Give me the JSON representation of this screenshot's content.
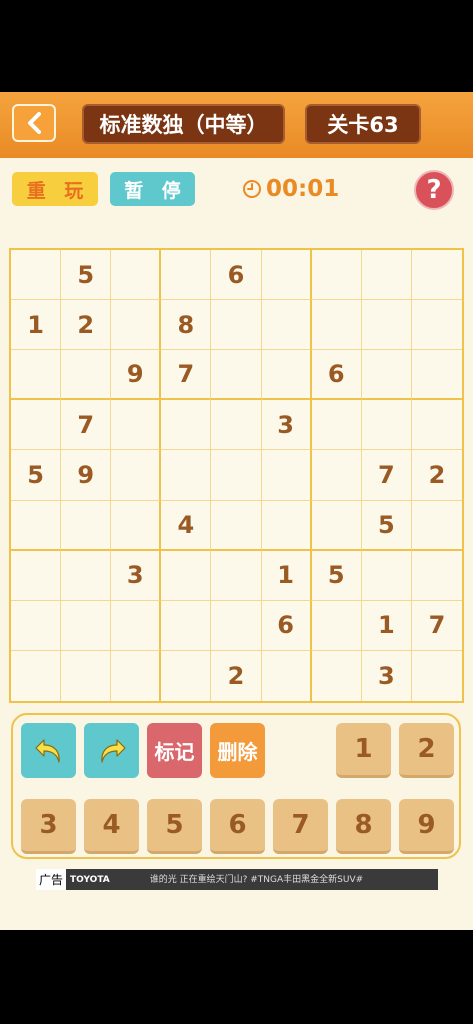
{
  "header": {
    "back_icon": "chevron-left-icon",
    "title": "标准数独（中等）",
    "level": "关卡63"
  },
  "controls": {
    "replay": "重 玩",
    "pause": "暂 停",
    "timer": "00:01",
    "help": "?"
  },
  "board": [
    [
      "",
      "5",
      "",
      "",
      "6",
      "",
      "",
      "",
      ""
    ],
    [
      "1",
      "2",
      "",
      "8",
      "",
      "",
      "",
      "",
      ""
    ],
    [
      "",
      "",
      "9",
      "7",
      "",
      "",
      "6",
      "",
      ""
    ],
    [
      "",
      "7",
      "",
      "",
      "",
      "3",
      "",
      "",
      ""
    ],
    [
      "5",
      "9",
      "",
      "",
      "",
      "",
      "",
      "7",
      "2"
    ],
    [
      "",
      "",
      "",
      "4",
      "",
      "",
      "",
      "5",
      ""
    ],
    [
      "",
      "",
      "3",
      "",
      "",
      "1",
      "5",
      "",
      ""
    ],
    [
      "",
      "",
      "",
      "",
      "",
      "6",
      "",
      "1",
      "7"
    ],
    [
      "",
      "",
      "",
      "",
      "2",
      "",
      "",
      "3",
      ""
    ]
  ],
  "pad": {
    "undo_icon": "undo-icon",
    "redo_icon": "redo-icon",
    "mark": "标记",
    "delete": "删除",
    "numbers": [
      "1",
      "2",
      "3",
      "4",
      "5",
      "6",
      "7",
      "8",
      "9"
    ]
  },
  "ad": {
    "tag": "广告",
    "brand": "TOYOTA",
    "text": "谁的光 正在重绘天门山? #TNGA丰田黑金全新SUV#"
  },
  "colors": {
    "accent_orange": "#e98a25",
    "digit_brown": "#9a5a24",
    "teal": "#5ec8cc",
    "grid_gold": "#efc24c"
  }
}
